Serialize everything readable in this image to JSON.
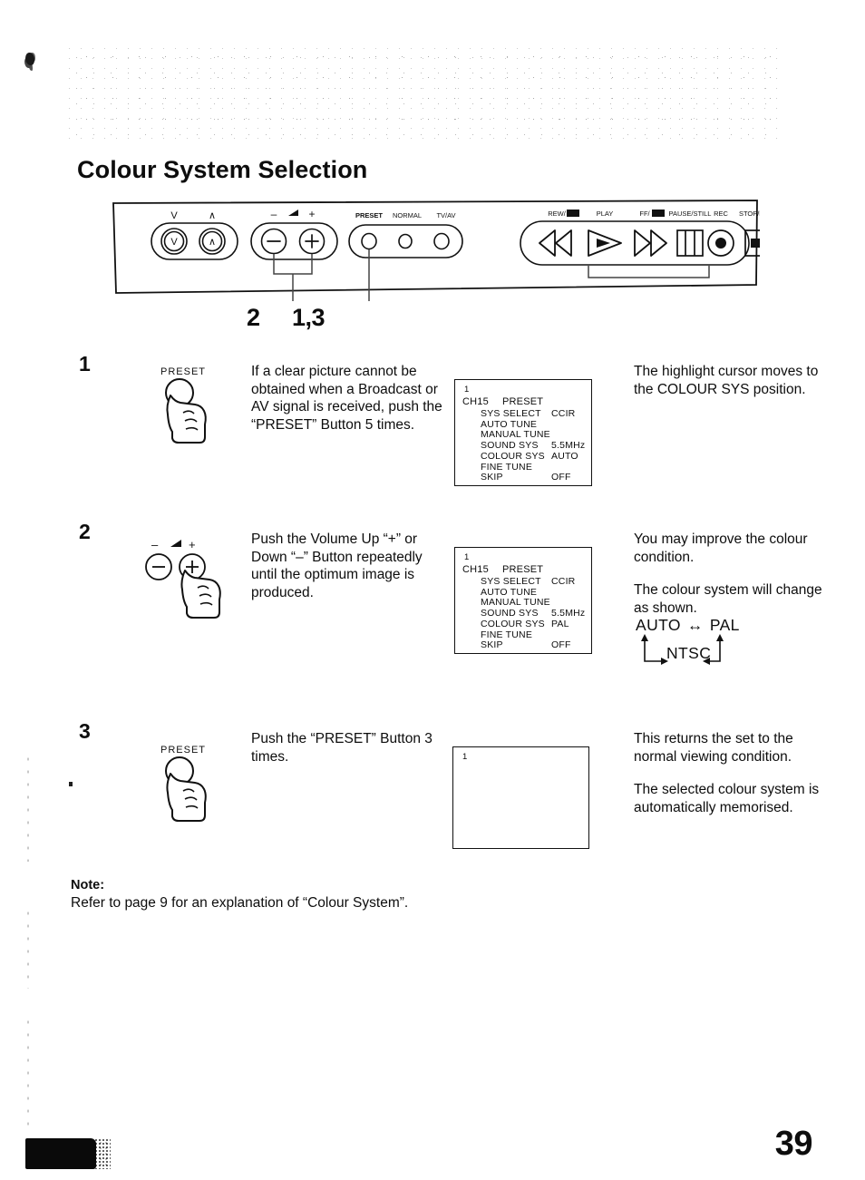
{
  "document": {
    "title": "Colour System Selection",
    "page_number": "39"
  },
  "control_panel": {
    "labels": {
      "channel_down": "V",
      "channel_up": "∧",
      "volume_down": "–",
      "volume_icon": "volume-wedge",
      "volume_up": "+",
      "preset": "PRESET",
      "normal": "NORMAL",
      "tv_av": "TV/AV",
      "rew": "REW/",
      "play": "PLAY",
      "ff": "FF/",
      "pause_still": "PAUSE/STILL",
      "rec": "REC",
      "stop_eject": "STOP/EJECT"
    },
    "callouts": {
      "volume": "2",
      "preset": "1,3"
    }
  },
  "steps": [
    {
      "number": "1",
      "button_label": "PRESET",
      "instruction": "If a clear picture cannot be obtained when a Broadcast or AV signal is received, push the “PRESET” Button 5 times.",
      "result": [
        "The highlight cursor moves to the COLOUR SYS position."
      ]
    },
    {
      "number": "2",
      "button_minus": "–",
      "button_plus": "+",
      "instruction": "Push the Volume Up “+” or Down “–” Button repeatedly until the optimum image is produced.",
      "result": [
        "You may improve the colour condition.",
        "The colour system will change as shown."
      ]
    },
    {
      "number": "3",
      "button_label": "PRESET",
      "instruction": "Push the “PRESET” Button 3 times.",
      "result": [
        "This returns the set to the normal viewing condition.",
        "The selected colour system is automatically memorised."
      ]
    }
  ],
  "osd_screens": [
    {
      "corner": "1",
      "channel": "CH15",
      "mode": "PRESET",
      "rows": [
        {
          "label": "SYS SELECT",
          "value": "CCIR"
        },
        {
          "label": "AUTO TUNE",
          "value": ""
        },
        {
          "label": "MANUAL TUNE",
          "value": ""
        },
        {
          "label": "SOUND SYS",
          "value": "5.5MHz"
        },
        {
          "label": "COLOUR SYS",
          "value": "AUTO"
        },
        {
          "label": "FINE TUNE",
          "value": ""
        },
        {
          "label": "SKIP",
          "value": "OFF"
        }
      ]
    },
    {
      "corner": "1",
      "channel": "CH15",
      "mode": "PRESET",
      "rows": [
        {
          "label": "SYS SELECT",
          "value": "CCIR"
        },
        {
          "label": "AUTO TUNE",
          "value": ""
        },
        {
          "label": "MANUAL TUNE",
          "value": ""
        },
        {
          "label": "SOUND SYS",
          "value": "5.5MHz"
        },
        {
          "label": "COLOUR SYS",
          "value": "PAL"
        },
        {
          "label": "FINE TUNE",
          "value": ""
        },
        {
          "label": "SKIP",
          "value": "OFF"
        }
      ]
    },
    {
      "corner": "1",
      "channel": "",
      "mode": "",
      "rows": []
    }
  ],
  "cycle_diagram": {
    "first": "AUTO",
    "double_arrow": "↔",
    "second": "PAL",
    "third": "NTSC",
    "bottom_line": "└→NTSC↵"
  },
  "note": {
    "label": "Note:",
    "text": "Refer to page 9 for an explanation of “Colour System”."
  }
}
